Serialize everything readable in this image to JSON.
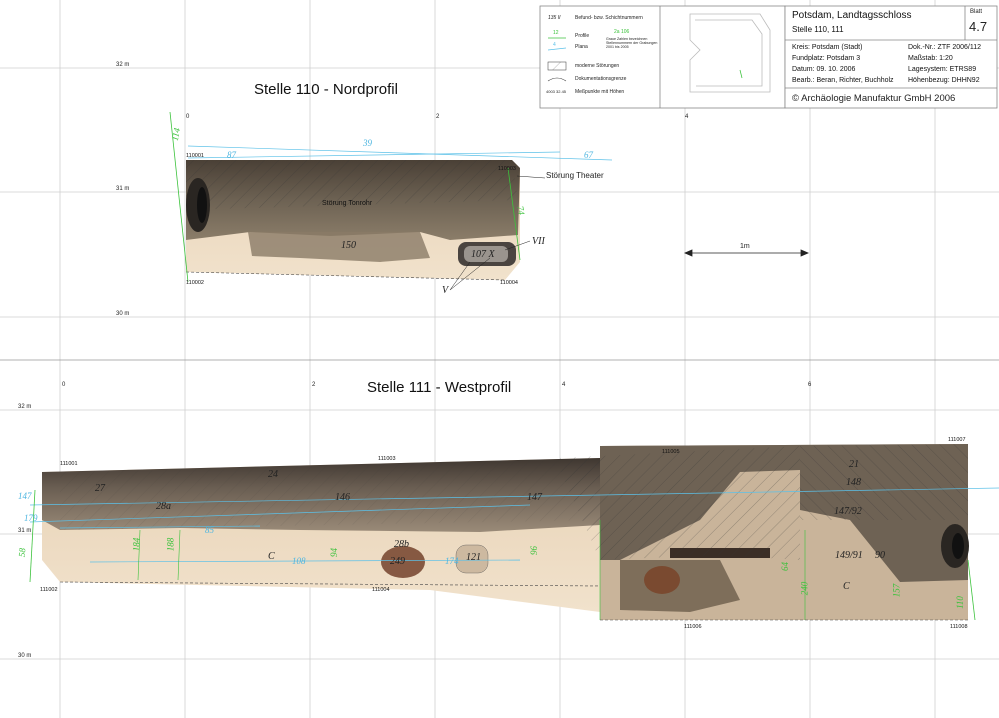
{
  "titleblock": {
    "project": "Potsdam, Landtagsschloss",
    "stellen": "Stelle 110, 111",
    "blatt_label": "Blatt",
    "blatt_no": "4.7",
    "kreis": "Kreis: Potsdam (Stadt)",
    "dok_nr": "Dok.-Nr.: ZTF 2006/112",
    "fundplatz": "Fundplatz: Potsdam 3",
    "massstab": "Maßstab: 1:20",
    "datum": "Datum: 09. 10. 2006",
    "lagesystem": "Lagesystem: ETRS89",
    "bearb": "Bearb.: Beran, Richter, Buchholz",
    "hoehenbezug": "Höhenbezug: DHHN92",
    "copyright": "© Archäologie Manufaktur GmbH 2006"
  },
  "legend": {
    "befund_sample": "135 II",
    "befund": "Befund- bzw. Schichtnummern",
    "profile_sample": "12",
    "profile": "Profile",
    "plana_sample": "4",
    "plana": "Plana",
    "grey_sample": "2a 106",
    "grey_note": "Graue Zahlen bezeichnen Stellennummern der Grabungen 2001 bis 2005",
    "stoerungen": "moderne Störungen",
    "dok_grenze": "Dokumentationsgrenze",
    "messpunkte_sample": "4003 32.45",
    "messpunkte": "Meßpunkte mit Höhen"
  },
  "nordprofil": {
    "title": "Stelle 110 - Nordprofil",
    "grid_x": [
      "0",
      "2",
      "4"
    ],
    "heights": [
      "32 m",
      "31 m",
      "30 m"
    ],
    "points": [
      "110001",
      "110002",
      "110003",
      "110004"
    ],
    "labels": {
      "st_theater": "Störung Theater",
      "st_tonrohr": "Störung Tonrohr",
      "l150": "150",
      "l107": "107 X",
      "lVII": "VII",
      "lV": "V"
    },
    "blue": [
      "39",
      "87",
      "67"
    ],
    "green": [
      "114",
      "74"
    ]
  },
  "scalebar": {
    "label": "1m"
  },
  "westprofil": {
    "title": "Stelle 111 - Westprofil",
    "grid_x": [
      "0",
      "2",
      "4",
      "6"
    ],
    "heights": [
      "32 m",
      "31 m",
      "30 m"
    ],
    "points": [
      "111001",
      "111002",
      "111003",
      "111004",
      "111005",
      "111006",
      "111007",
      "111008"
    ],
    "layers": [
      "27",
      "24",
      "28a",
      "146",
      "147",
      "21",
      "148",
      "147/92",
      "C",
      "28b",
      "249",
      "121",
      "149/91",
      "90",
      "C"
    ],
    "blue": [
      "147",
      "179",
      "85",
      "108",
      "174"
    ],
    "green": [
      "58",
      "184",
      "188",
      "94",
      "96",
      "64",
      "240",
      "157",
      "110"
    ]
  }
}
